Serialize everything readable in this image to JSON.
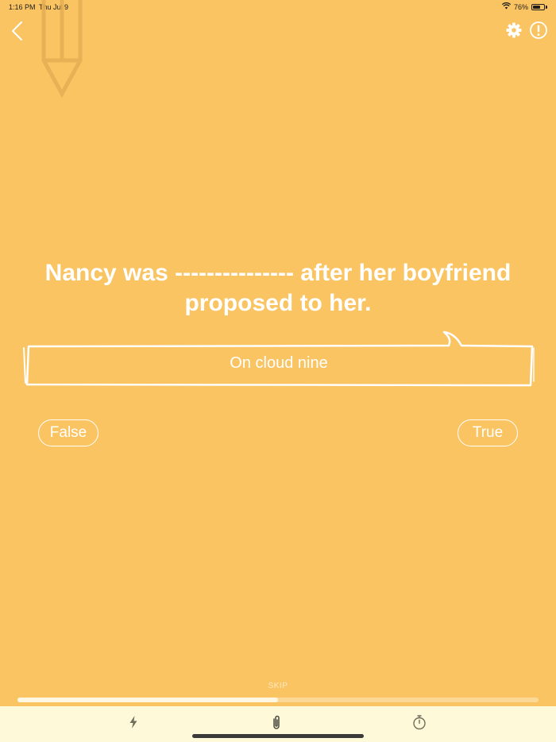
{
  "status_bar": {
    "time": "1:16 PM",
    "date": "Thu Jul 9",
    "battery": "76%",
    "battery_level": 0.76,
    "icons": [
      "wifi-icon",
      "battery-icon"
    ]
  },
  "header": {
    "icons": [
      "chevron-left-icon",
      "pencil-icon",
      "gear-icon",
      "exclamation-circle-icon"
    ]
  },
  "question": {
    "text": "Nancy was --------------- after her boyfriend proposed to her."
  },
  "answer": {
    "text": "On cloud nine"
  },
  "choices": {
    "false_label": "False",
    "true_label": "True"
  },
  "progress": {
    "skip_label": "SKIP",
    "fraction": 0.5
  },
  "bottom_bar": {
    "tabs": [
      "lightning-icon",
      "paperclip-icon",
      "stopwatch-icon"
    ]
  },
  "colors": {
    "background": "#FAC462",
    "bottom_bar": "#FEF9D9",
    "text": "#FFFFFF"
  }
}
